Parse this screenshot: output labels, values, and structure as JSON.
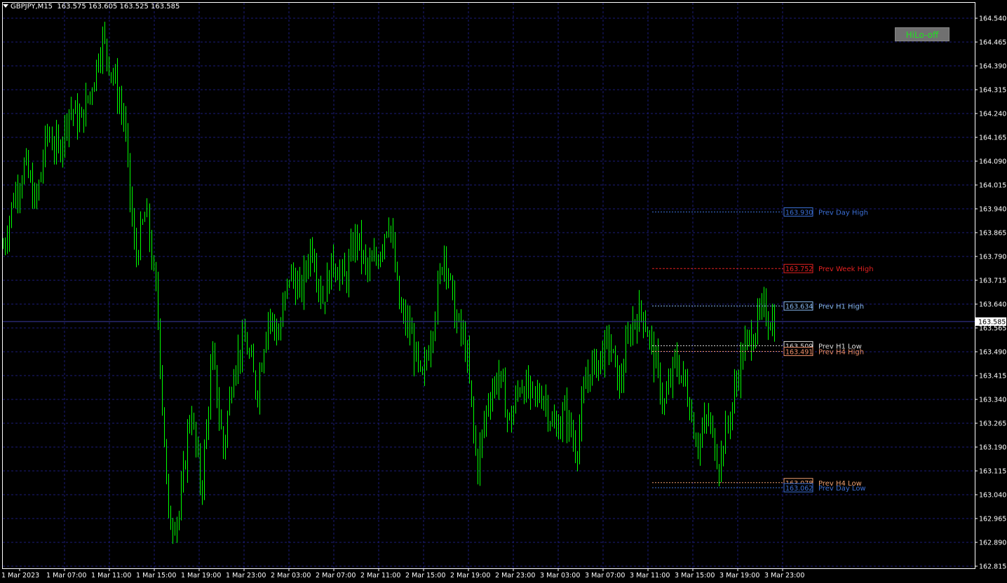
{
  "header": {
    "symbol": "GBPJPY,M15",
    "ohlc": "163.575 163.605 163.525 163.585"
  },
  "button": {
    "label": "HiLo-off"
  },
  "colors": {
    "background": "#000000",
    "grid": "#1c1c7a",
    "candle": "#00ff00",
    "axis_text": "#ffffff"
  },
  "chart_data": {
    "type": "candlestick",
    "symbol": "GBPJPY",
    "timeframe": "M15",
    "ylim": [
      162.815,
      164.575
    ],
    "y_ticks": [
      "164.540",
      "164.465",
      "164.390",
      "164.315",
      "164.240",
      "164.165",
      "164.090",
      "164.015",
      "163.940",
      "163.865",
      "163.790",
      "163.715",
      "163.640",
      "163.565",
      "163.490",
      "163.415",
      "163.340",
      "163.265",
      "163.190",
      "163.115",
      "163.040",
      "162.965",
      "162.890",
      "162.815"
    ],
    "x_ticks": [
      "1 Mar 2023",
      "1 Mar 07:00",
      "1 Mar 11:00",
      "1 Mar 15:00",
      "1 Mar 19:00",
      "1 Mar 23:00",
      "2 Mar 03:00",
      "2 Mar 07:00",
      "2 Mar 11:00",
      "2 Mar 15:00",
      "2 Mar 19:00",
      "2 Mar 23:00",
      "3 Mar 03:00",
      "3 Mar 07:00",
      "3 Mar 11:00",
      "3 Mar 15:00",
      "3 Mar 19:00",
      "3 Mar 23:00"
    ],
    "current_price": {
      "value": 163.585,
      "label": "163.585"
    },
    "price_path": [
      163.82,
      163.98,
      164.08,
      163.95,
      164.18,
      164.12,
      164.26,
      164.21,
      164.32,
      164.48,
      164.36,
      164.22,
      163.78,
      163.93,
      163.62,
      162.95,
      162.98,
      163.32,
      163.05,
      163.48,
      163.18,
      163.46,
      163.52,
      163.36,
      163.61,
      163.54,
      163.74,
      163.67,
      163.84,
      163.65,
      163.78,
      163.71,
      163.86,
      163.74,
      163.79,
      163.92,
      163.62,
      163.55,
      163.38,
      163.58,
      163.82,
      163.6,
      163.5,
      163.12,
      163.34,
      163.42,
      163.26,
      163.4,
      163.34,
      163.36,
      163.24,
      163.3,
      163.18,
      163.42,
      163.46,
      163.52,
      163.38,
      163.58,
      163.62,
      163.48,
      163.32,
      163.46,
      163.38,
      163.2,
      163.28,
      163.14,
      163.3,
      163.48,
      163.55,
      163.62,
      163.58
    ],
    "levels": [
      {
        "value": 163.93,
        "label": "163.930",
        "name": "Prev Day High",
        "color": "#3b6fd6",
        "dash": "2,2"
      },
      {
        "value": 163.752,
        "label": "163.752",
        "name": "Prev Week High",
        "color": "#e22020",
        "dash": "3,2"
      },
      {
        "value": 163.634,
        "label": "163.634",
        "name": "Prev H1 High",
        "color": "#87b8f0",
        "dash": "2,2"
      },
      {
        "value": 163.509,
        "label": "163.509",
        "name": "Prev H1 Low",
        "color": "#dcdcdc",
        "dash": "2,2"
      },
      {
        "value": 163.491,
        "label": "163.491",
        "name": "Prev H4 High",
        "color": "#f0906a",
        "dash": "2,2"
      },
      {
        "value": 163.078,
        "label": "163.078",
        "name": "Prev H4 Low",
        "color": "#f0a070",
        "dash": "2,2"
      },
      {
        "value": 163.062,
        "label": "163.062",
        "name": "Prev Day Low",
        "color": "#3b6fd6",
        "dash": "2,2"
      }
    ]
  }
}
